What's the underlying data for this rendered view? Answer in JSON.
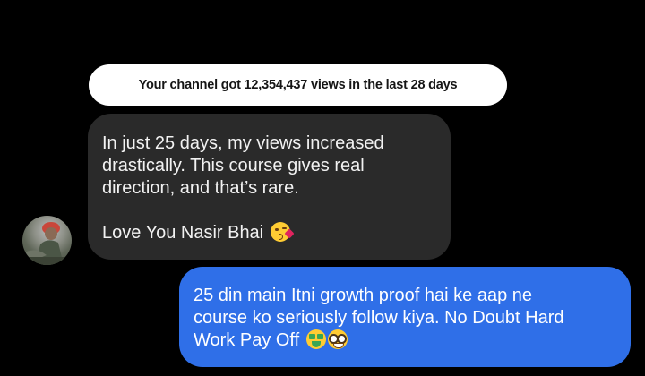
{
  "stat_banner": {
    "text": "Your channel got 12,354,437 views in the last 28 days"
  },
  "incoming_message": {
    "lines": [
      "In just 25 days, my views increased",
      "drastically. This course gives real",
      "direction, and that’s rare.",
      "Love You Nasir Bhai"
    ],
    "emoji": [
      "kissing-heart-emoji"
    ]
  },
  "outgoing_message": {
    "lines": [
      "25 din main Itni growth proof hai ke aap ne",
      "course ko seriously follow kiya. No Doubt Hard",
      "Work Pay Off"
    ],
    "emoji": [
      "money-mouth-emoji",
      "nerd-face-emoji"
    ]
  },
  "colors": {
    "background": "#000000",
    "stat_pill": "#ffffff",
    "incoming_bubble": "#2a2a2a",
    "outgoing_bubble": "#2f6fe8"
  },
  "avatar": {
    "icon": "user-avatar-photo"
  }
}
